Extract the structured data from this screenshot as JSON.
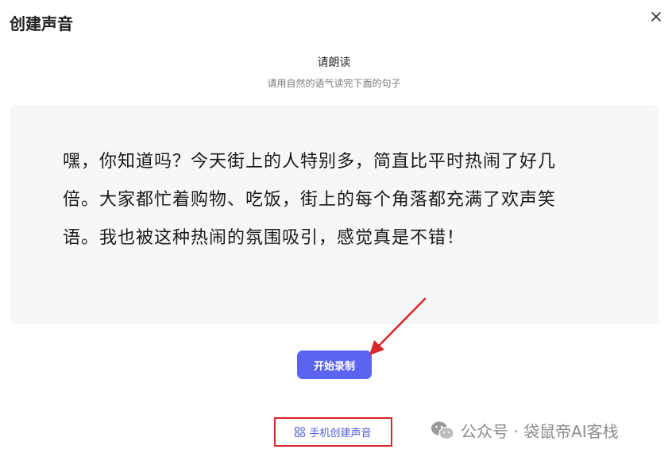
{
  "dialog": {
    "title": "创建声音",
    "close_icon": "close-icon"
  },
  "prompt": {
    "instruction": "请朗读",
    "subinstruction": "请用自然的语气读完下面的句子"
  },
  "reading": {
    "text": "嘿，你知道吗？今天街上的人特别多，简直比平时热闹了好几倍。大家都忙着购物、吃饭，街上的每个角落都充满了欢声笑语。我也被这种热闹的氛围吸引，感觉真是不错！"
  },
  "actions": {
    "start_record_label": "开始录制",
    "phone_create_label": "手机创建声音",
    "phone_icon": "qr-grid-icon"
  },
  "watermark": {
    "text": "公众号 · 袋鼠帝AI客栈",
    "icon": "wechat-icon"
  },
  "colors": {
    "primary": "#5b63f0",
    "link": "#4f5cd6",
    "annotation_red": "#d8262a",
    "panel_bg": "#f6f7f9"
  }
}
